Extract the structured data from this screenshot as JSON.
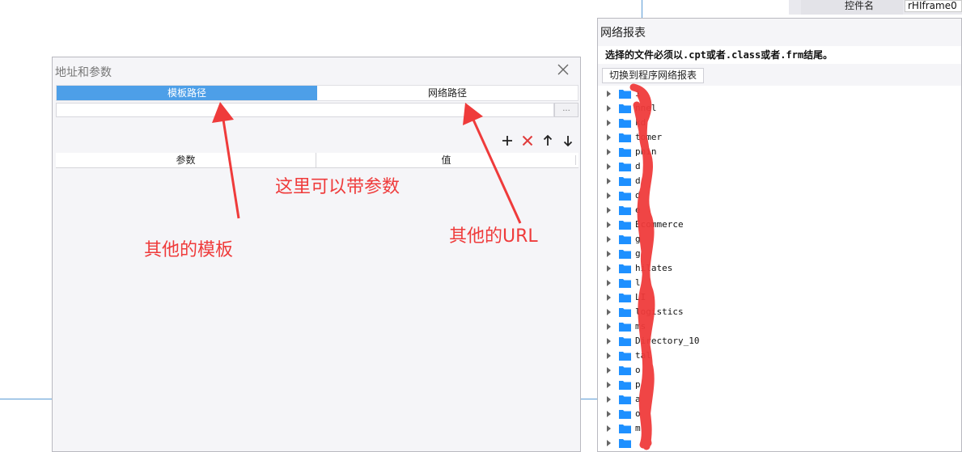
{
  "property_panel": {
    "label": "控件名",
    "value": "rHIframe0"
  },
  "address_dialog": {
    "title": "地址和参数",
    "tabs": [
      {
        "label": "模板路径",
        "active": true
      },
      {
        "label": "网络路径",
        "active": false
      }
    ],
    "path_value": "",
    "browse_label": "...",
    "toolbar": [
      "add-icon",
      "delete-icon",
      "arrow-up-icon",
      "arrow-down-icon"
    ],
    "table_headers": {
      "param": "参数",
      "value": "值"
    }
  },
  "network_dialog": {
    "title": "网络报表",
    "note": "选择的文件必须以.cpt或者.class或者.frm结尾。",
    "switch_button": "切换到程序网络报表",
    "tree_items": [
      "i",
      "nnel",
      "kd",
      "tomer",
      "phin",
      "d",
      "d",
      "d",
      "e",
      "Ecommerce",
      "g",
      "g",
      "hilates",
      "l",
      "LI",
      "logistics",
      "ms",
      "Directory_10",
      "tal",
      "o",
      "p",
      "a",
      "o",
      "m",
      ""
    ]
  },
  "annotations": {
    "params": "这里可以带参数",
    "templates": "其他的模板",
    "url": "其他的URL"
  },
  "colors": {
    "accent_tab": "#4d9fe8",
    "annotation_red": "#ef3b3b",
    "folder_blue": "#1e90ff",
    "delete_red": "#e03b3b"
  }
}
